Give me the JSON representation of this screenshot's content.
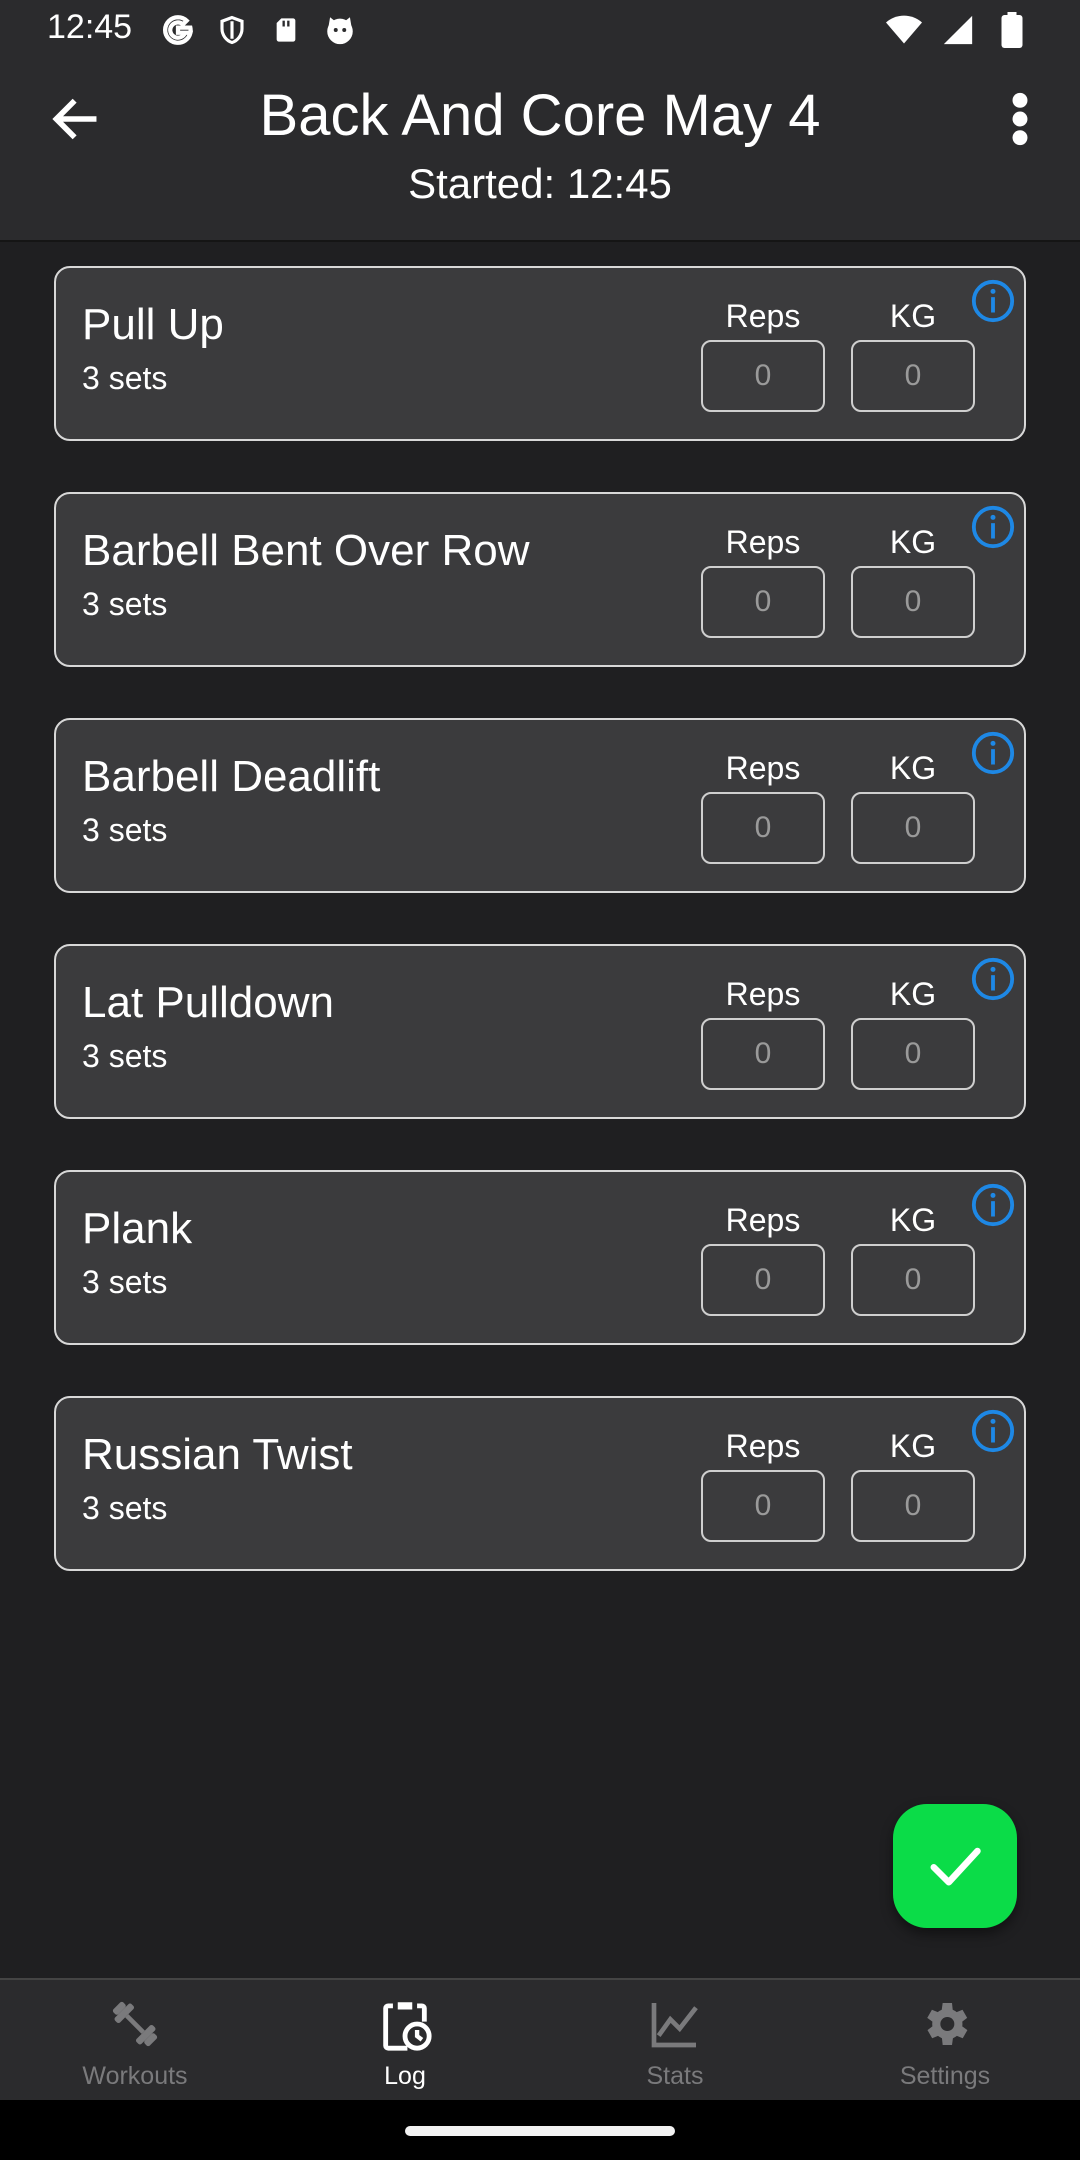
{
  "status_bar": {
    "time": "12:45",
    "left_icons": [
      "google-icon",
      "shield-icon",
      "sd-card-icon",
      "cat-face-icon"
    ],
    "right_icons": [
      "wifi-icon",
      "signal-icon",
      "battery-icon"
    ]
  },
  "header": {
    "title": "Back And Core May 4",
    "subtitle": "Started: 12:45"
  },
  "columns": {
    "reps": "Reps",
    "kg": "KG"
  },
  "exercises": [
    {
      "name": "Pull Up",
      "sets": "3 sets",
      "reps_placeholder": "0",
      "kg_placeholder": "0"
    },
    {
      "name": "Barbell Bent Over Row",
      "sets": "3 sets",
      "reps_placeholder": "0",
      "kg_placeholder": "0"
    },
    {
      "name": "Barbell Deadlift",
      "sets": "3 sets",
      "reps_placeholder": "0",
      "kg_placeholder": "0"
    },
    {
      "name": "Lat Pulldown",
      "sets": "3 sets",
      "reps_placeholder": "0",
      "kg_placeholder": "0"
    },
    {
      "name": "Plank",
      "sets": "3 sets",
      "reps_placeholder": "0",
      "kg_placeholder": "0"
    },
    {
      "name": "Russian Twist",
      "sets": "3 sets",
      "reps_placeholder": "0",
      "kg_placeholder": "0"
    }
  ],
  "fab": {
    "icon": "check-icon",
    "color": "#0bdc48"
  },
  "bottom_nav": [
    {
      "label": "Workouts",
      "icon": "dumbbell-icon",
      "active": false
    },
    {
      "label": "Log",
      "icon": "clipboard-clock-icon",
      "active": true
    },
    {
      "label": "Stats",
      "icon": "line-chart-icon",
      "active": false
    },
    {
      "label": "Settings",
      "icon": "gear-icon",
      "active": false
    }
  ],
  "colors": {
    "background": "#1f1f21",
    "surface": "#2b2b2d",
    "card": "#3b3b3d",
    "info_accent": "#1e88e5",
    "fab": "#0bdc48"
  }
}
